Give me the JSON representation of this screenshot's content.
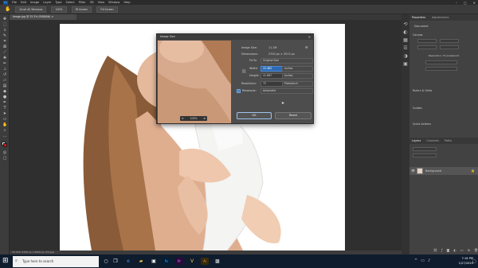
{
  "menubar": {
    "logo": "Ps",
    "items": [
      "File",
      "Edit",
      "Image",
      "Layer",
      "Type",
      "Select",
      "Filter",
      "3D",
      "View",
      "Window",
      "Help"
    ],
    "window_controls": [
      "–",
      "□",
      "✕"
    ]
  },
  "options_bar": {
    "buttons": [
      "Scroll All Windows",
      "100%",
      "Fit Screen",
      "Fill Screen"
    ]
  },
  "doc_tab": {
    "label": "Image.jpg @ 33.3% (RGB/8#) ×"
  },
  "dialog": {
    "title": "Image Size",
    "close": "×",
    "preview_zoom": "100%",
    "image_size_label": "Image Size:",
    "image_size_value": "11.1M",
    "dimensions_label": "Dimensions:",
    "dimensions_value": "2700 px × 3513 px",
    "fit_to_label": "Fit To:",
    "fit_to_value": "Original Size",
    "width_label": "Width:",
    "width_value": "22.485",
    "width_unit": "Inches",
    "height_label": "Height:",
    "height_value": "41.667",
    "height_unit": "Inches",
    "resolution_label": "Resolution:",
    "resolution_value": "72",
    "resolution_unit": "Pixels/Inch",
    "resample_label": "Resample:",
    "resample_value": "Automatic",
    "ok_label": "OK",
    "cancel_label": "Reset"
  },
  "panels": {
    "top_tabs": [
      "Properties",
      "Adjustments"
    ],
    "document_label": "Document",
    "canvas_label": "Canvas",
    "resolution_text": "Resolution: 72 pixels/inch",
    "rulers_label": "Rulers & Grids",
    "guides_label": "Guides",
    "quick_actions_label": "Quick Actions",
    "layer_tabs": [
      "Layers",
      "Channels",
      "Paths"
    ],
    "layer_name": "Background"
  },
  "status_bar": {
    "text": "33.33%    2700 px x 5000 px (72 ppi)"
  },
  "taskbar": {
    "search_placeholder": "Type here to search",
    "time": "7:16 PM",
    "date": "1/27/2020"
  },
  "colors": {
    "ps_blue": "#31a8ff",
    "accent_selected": "#2c6bb3",
    "taskbar": "#0f1c2e"
  }
}
